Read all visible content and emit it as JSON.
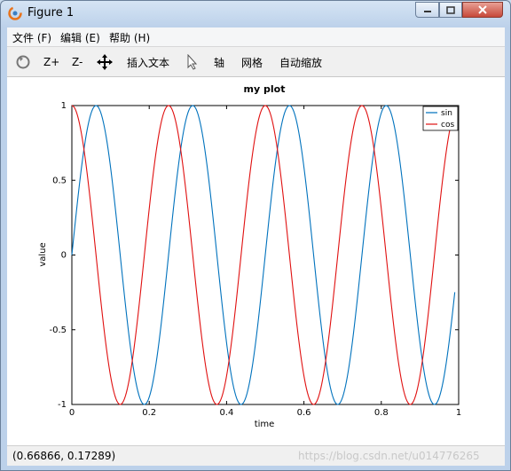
{
  "window": {
    "title": "Figure 1"
  },
  "menu": [
    {
      "label": "文件 (F)"
    },
    {
      "label": "编辑 (E)"
    },
    {
      "label": "帮助 (H)"
    }
  ],
  "toolbar": {
    "rotate_icon": "rotate-icon",
    "zoom_in": "Z+",
    "zoom_out": "Z-",
    "pan_icon": "pan-arrows-icon",
    "insert_text": "插入文本",
    "select_icon": "cursor-arrow-icon",
    "axis": "轴",
    "grid": "网格",
    "autoscale": "自动缩放"
  },
  "status": {
    "coordinates": "(0.66866, 0.17289)",
    "watermark": "https://blog.csdn.net/u014776265"
  },
  "chart_data": {
    "type": "line",
    "title": "my plot",
    "xlabel": "time",
    "ylabel": "value",
    "xlim": [
      0,
      1
    ],
    "ylim": [
      -1,
      1
    ],
    "x_ticks": [
      "0",
      "0.2",
      "0.4",
      "0.6",
      "0.8",
      "1"
    ],
    "y_ticks": [
      "-1",
      "-0.5",
      "0",
      "0.5",
      "1"
    ],
    "legend_position": "top-right",
    "x_range_plotted": [
      0,
      0.99
    ],
    "frequency_hz": 4,
    "series": [
      {
        "name": "sin",
        "function": "sin(2*pi*4*t)",
        "color": "#0072bd"
      },
      {
        "name": "cos",
        "function": "cos(2*pi*4*t)",
        "color": "#e01010"
      }
    ]
  }
}
